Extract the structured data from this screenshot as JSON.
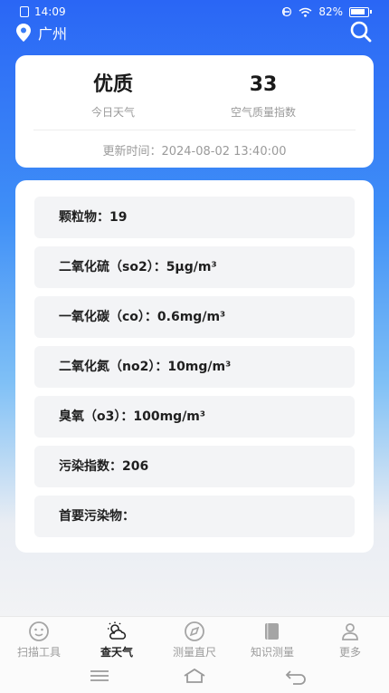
{
  "status_bar": {
    "time": "14:09",
    "battery": "82%"
  },
  "header": {
    "city": "广州"
  },
  "summary": {
    "quality_value": "优质",
    "quality_label": "今日天气",
    "aqi_value": "33",
    "aqi_label": "空气质量指数",
    "update_text": "更新时间：2024-08-02 13:40:00"
  },
  "pollutants": [
    {
      "text": "颗粒物：19"
    },
    {
      "text": "二氧化硫（so2）：5μg/m³"
    },
    {
      "text": "一氧化碳（co）：0.6mg/m³"
    },
    {
      "text": "二氧化氮（no2）：10mg/m³"
    },
    {
      "text": "臭氧（o3）：100mg/m³"
    },
    {
      "text": "污染指数：206"
    },
    {
      "text": "首要污染物："
    }
  ],
  "tabs": [
    {
      "label": "扫描工具",
      "icon": "scan-face-icon"
    },
    {
      "label": "查天气",
      "icon": "weather-icon",
      "active": true
    },
    {
      "label": "测量直尺",
      "icon": "compass-icon"
    },
    {
      "label": "知识测量",
      "icon": "book-icon"
    },
    {
      "label": "更多",
      "icon": "person-icon"
    }
  ],
  "colors": {
    "accent": "#2a66f5",
    "card": "#ffffff",
    "item_bg": "#f3f4f6"
  }
}
